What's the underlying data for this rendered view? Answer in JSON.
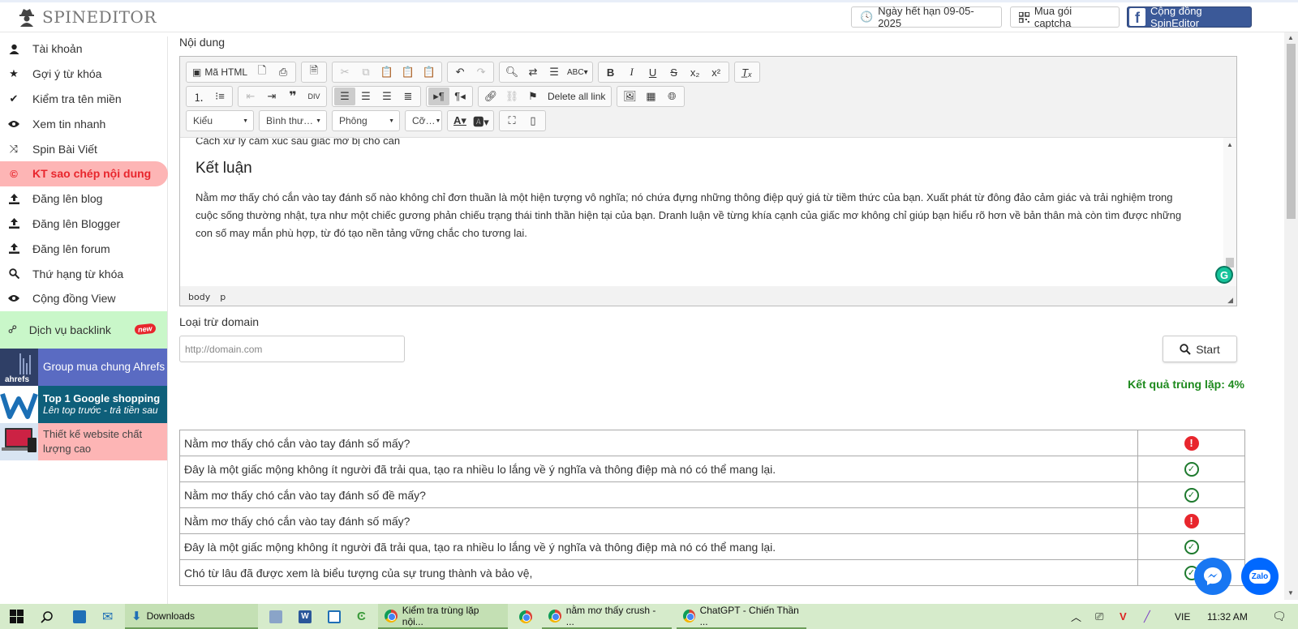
{
  "header": {
    "logo": "SPINEDITOR",
    "expiry": "Ngày hết hạn 09-05-2025",
    "captcha": "Mua gói captcha",
    "community": "Cộng đồng SpinEditor"
  },
  "sidebar": {
    "items": [
      {
        "label": "Tài khoản",
        "icon": "user-icon"
      },
      {
        "label": "Gợi ý từ khóa",
        "icon": "star-icon"
      },
      {
        "label": "Kiểm tra tên miền",
        "icon": "check-icon"
      },
      {
        "label": "Xem tin nhanh",
        "icon": "eye-icon"
      },
      {
        "label": "Spin Bài Viết",
        "icon": "shuffle-icon"
      },
      {
        "label": "KT sao chép nội dung",
        "icon": "copyright-icon"
      },
      {
        "label": "Đăng lên blog",
        "icon": "upload-icon"
      },
      {
        "label": "Đăng lên Blogger",
        "icon": "upload-icon"
      },
      {
        "label": "Đăng lên forum",
        "icon": "upload-icon"
      },
      {
        "label": "Thứ hạng từ khóa",
        "icon": "search-icon"
      },
      {
        "label": "Cộng đồng View",
        "icon": "eye-icon"
      }
    ],
    "backlink": {
      "label": "Dịch vụ backlink",
      "badge": "new"
    },
    "promos": {
      "ahrefs": {
        "brand": "ahrefs",
        "text": "Group mua chung Ahrefs"
      },
      "google": {
        "title": "Top 1 Google shopping",
        "subtitle": "Lên top trước - trả tiền sau"
      },
      "web": {
        "text": "Thiết kế website chất lượng cao"
      }
    }
  },
  "editor": {
    "section_label": "Nội dung",
    "toolbar": {
      "source_label": "Mã HTML",
      "delete_links_label": "Delete all link",
      "style_combo": "Kiểu",
      "format_combo": "Bình thư…",
      "font_combo": "Phông",
      "size_combo": "Cỡ…"
    },
    "content": {
      "cut_line": "Cách xử lý cảm xúc sau giấc mơ bị chó cắn",
      "heading": "Kết luận",
      "paragraph": "Nằm mơ thấy chó cắn vào tay đánh số nào không chỉ đơn thuần là một hiện tượng vô nghĩa; nó chứa đựng những thông điệp quý giá từ tiềm thức của bạn. Xuất phát từ đông đảo cảm giác và trải nghiệm trong cuộc sống thường nhật, tựa như một chiếc gương phản chiếu trạng thái tinh thần hiện tại của bạn. Dranh luận về từng khía cạnh của giấc mơ không chỉ giúp bạn hiểu rõ hơn về bản thân mà còn tìm được những con số may mắn phù hợp, từ đó tạo nền tảng vững chắc cho tương lai."
    },
    "status_path": [
      "body",
      "p"
    ]
  },
  "exclude": {
    "label": "Loại trừ domain",
    "placeholder": "http://domain.com",
    "start_label": "Start"
  },
  "result": {
    "text": "Kết quả trùng lặp: 4%"
  },
  "rows": [
    {
      "text": "Nằm mơ thấy chó cắn vào tay đánh số mấy?",
      "status": "duplicate"
    },
    {
      "text": "Đây là một giấc mộng không ít người đã trải qua, tạo ra nhiều lo lắng về ý nghĩa và thông điệp mà nó có thể mang lại.",
      "status": "ok"
    },
    {
      "text": "Nằm mơ thấy chó cắn vào tay đánh số đề mấy?",
      "status": "ok"
    },
    {
      "text": "Nằm mơ thấy chó cắn vào tay đánh số mấy?",
      "status": "duplicate"
    },
    {
      "text": "Đây là một giấc mộng không ít người đã trải qua, tạo ra nhiều lo lắng về ý nghĩa và thông điệp mà nó có thể mang lại.",
      "status": "ok"
    },
    {
      "text": "Chó từ lâu đã được xem là biểu tượng của sự trung thành và bảo vệ,",
      "status": "ok"
    }
  ],
  "floating": {
    "zalo": "Zalo"
  },
  "taskbar": {
    "downloads": "Downloads",
    "tab1": "Kiểm tra trùng lặp nội...",
    "tab2": "nằm mơ thấy crush - ...",
    "tab3": "ChatGPT - Chiến Thần ...",
    "lang": "VIE",
    "time": "11:32 AM"
  },
  "colors": {
    "active_nav_bg": "#fdb5b5",
    "active_nav_text": "#e8262d",
    "result_green": "#1e8a1e",
    "facebook_blue": "#3b5998",
    "taskbar_bg": "#d6ebcb"
  }
}
